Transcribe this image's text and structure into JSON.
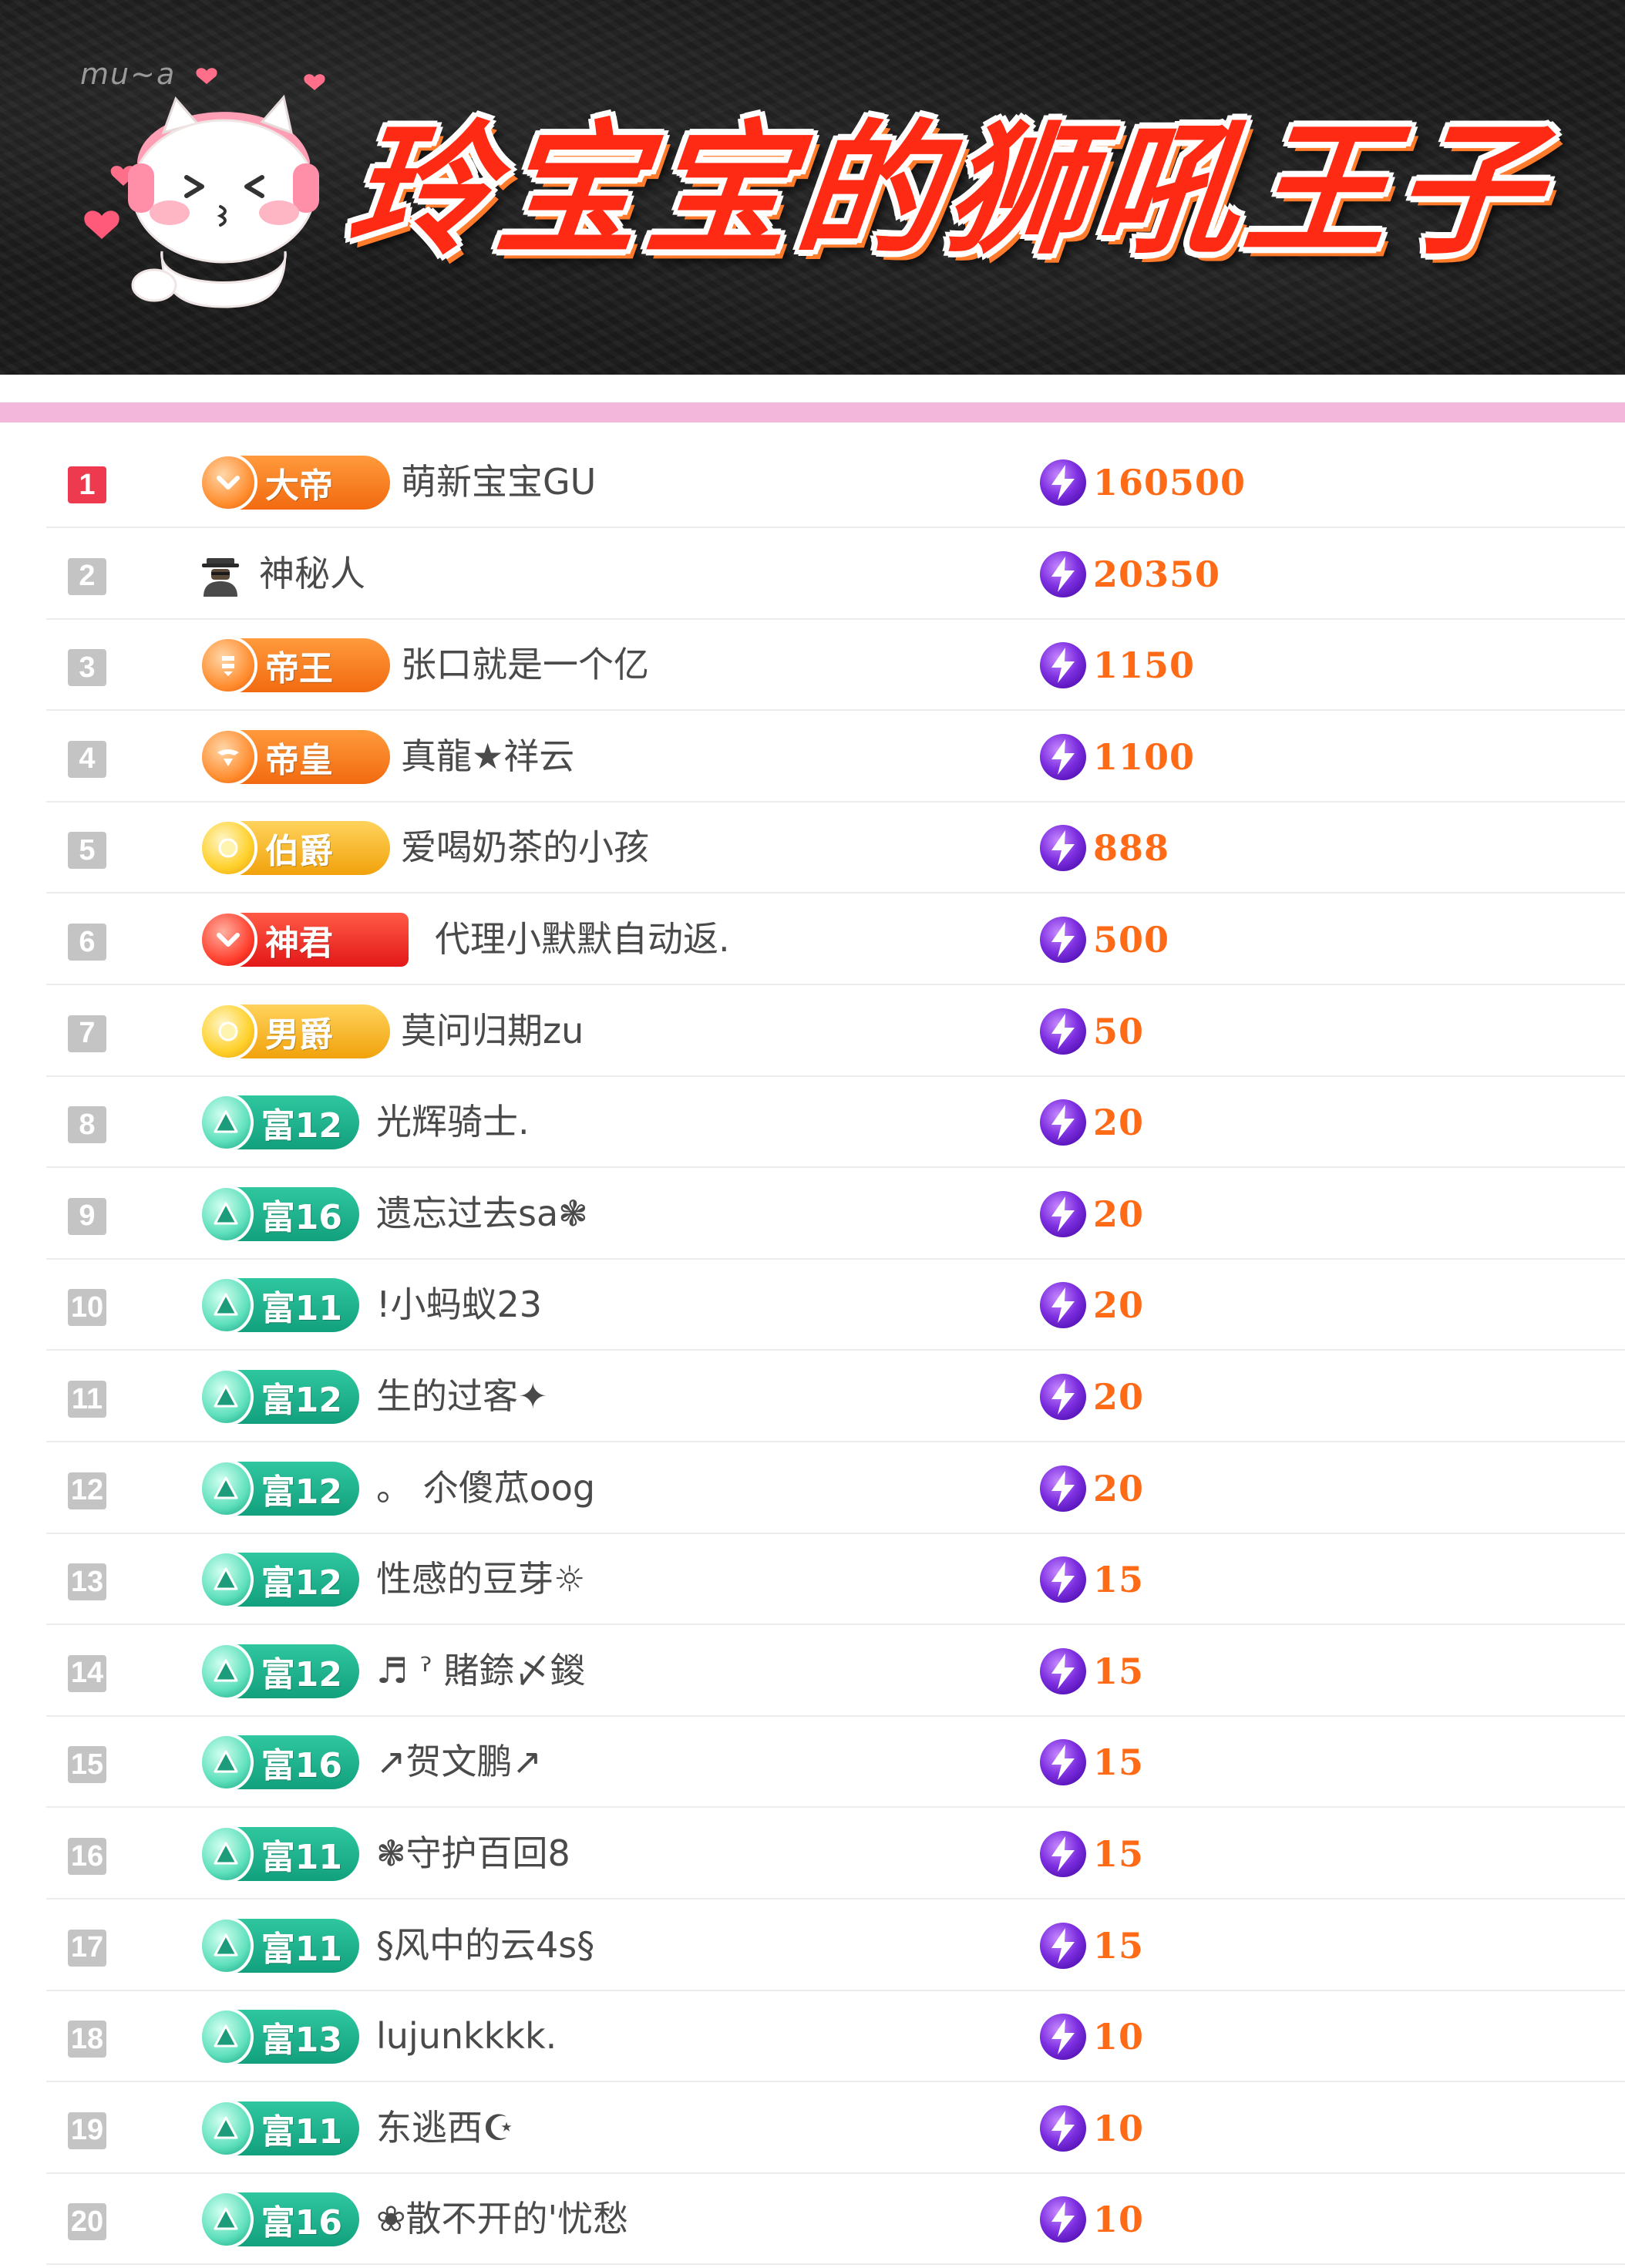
{
  "header": {
    "title": "玲宝宝的狮吼王子",
    "mascot_tag": "mu~a"
  },
  "colors": {
    "rank_top": "#ee3a4e",
    "rank_default": "#c4c4c4",
    "score_text": "#ff6a17",
    "divider": "#f3b7dc",
    "badge_orange": "#f26a10",
    "badge_red": "#e21818",
    "badge_gold": "#f1a20c",
    "badge_green": "#12a07d"
  },
  "rows": [
    {
      "rank": "1",
      "badge": "大帝",
      "badge_style": "orange",
      "badge_icon": "chevron-down-icon",
      "name": "萌新宝宝GU",
      "score": "160500"
    },
    {
      "rank": "2",
      "badge": "",
      "badge_style": "mystery",
      "badge_icon": "mystery-person-icon",
      "name": "神秘人",
      "score": "20350"
    },
    {
      "rank": "3",
      "badge": "帝王",
      "badge_style": "orange",
      "badge_icon": "crown-icon",
      "name": "张口就是一个亿",
      "score": "1150"
    },
    {
      "rank": "4",
      "badge": "帝皇",
      "badge_style": "orange",
      "badge_icon": "wing-icon",
      "name": "真龍★祥云",
      "score": "1100"
    },
    {
      "rank": "5",
      "badge": "伯爵",
      "badge_style": "gold",
      "badge_icon": "orb-icon",
      "name": "爱喝奶茶的小孩",
      "score": "888"
    },
    {
      "rank": "6",
      "badge": "神君",
      "badge_style": "red",
      "badge_icon": "chevron-down-icon",
      "name": "代理小默默自动返.",
      "score": "500"
    },
    {
      "rank": "7",
      "badge": "男爵",
      "badge_style": "gold",
      "badge_icon": "orb-icon",
      "name": "莫问归期zu",
      "score": "50"
    },
    {
      "rank": "8",
      "badge": "富12",
      "badge_style": "green",
      "badge_icon": "triangle-icon",
      "name": "光辉骑士.",
      "score": "20"
    },
    {
      "rank": "9",
      "badge": "富16",
      "badge_style": "green",
      "badge_icon": "triangle-icon",
      "name": "遗忘过去sa❃",
      "score": "20"
    },
    {
      "rank": "10",
      "badge": "富11",
      "badge_style": "green",
      "badge_icon": "triangle-icon",
      "name": "!小蚂蚁23",
      "score": "20"
    },
    {
      "rank": "11",
      "badge": "富12",
      "badge_style": "green",
      "badge_icon": "triangle-icon",
      "name": "生的过客✦",
      "score": "20"
    },
    {
      "rank": "12",
      "badge": "富12",
      "badge_style": "green",
      "badge_icon": "triangle-icon",
      "name": "。 尒傻苽oog",
      "score": "20"
    },
    {
      "rank": "13",
      "badge": "富12",
      "badge_style": "green",
      "badge_icon": "triangle-icon",
      "name": "性感的豆芽☼",
      "score": "15"
    },
    {
      "rank": "14",
      "badge": "富12",
      "badge_style": "green",
      "badge_icon": "triangle-icon",
      "name": "♬ ˀ 賭錼〆鍐",
      "score": "15"
    },
    {
      "rank": "15",
      "badge": "富16",
      "badge_style": "green",
      "badge_icon": "triangle-icon",
      "name": "↗贺文鹏↗",
      "score": "15"
    },
    {
      "rank": "16",
      "badge": "富11",
      "badge_style": "green",
      "badge_icon": "triangle-icon",
      "name": "❃守护百回8",
      "score": "15"
    },
    {
      "rank": "17",
      "badge": "富11",
      "badge_style": "green",
      "badge_icon": "triangle-icon",
      "name": "§风中的云4s§",
      "score": "15"
    },
    {
      "rank": "18",
      "badge": "富13",
      "badge_style": "green",
      "badge_icon": "triangle-icon",
      "name": "lujunkkkk.",
      "score": "10"
    },
    {
      "rank": "19",
      "badge": "富11",
      "badge_style": "green",
      "badge_icon": "triangle-icon",
      "name": "东逃西☪",
      "score": "10"
    },
    {
      "rank": "20",
      "badge": "富16",
      "badge_style": "green",
      "badge_icon": "triangle-icon",
      "name": "❀散不开的'忧愁",
      "score": "10"
    }
  ]
}
